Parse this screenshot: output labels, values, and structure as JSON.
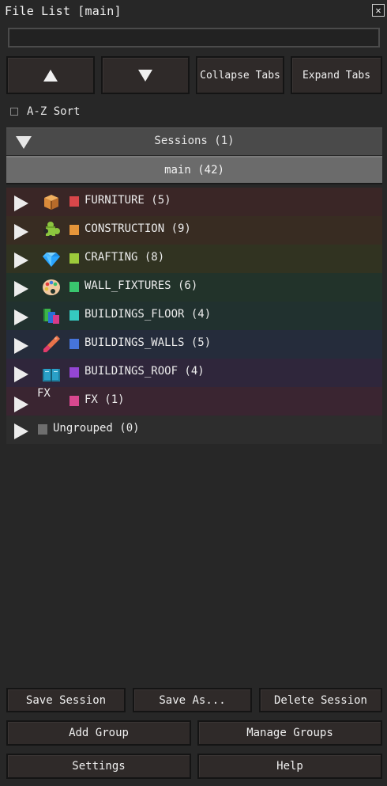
{
  "window": {
    "title": "File List [main]",
    "close_glyph": "✕"
  },
  "search": {
    "value": "",
    "placeholder": ""
  },
  "nav_buttons": {
    "up_icon": "arrow-up-icon",
    "down_icon": "arrow-down-icon",
    "collapse": "Collapse Tabs",
    "expand": "Expand Tabs"
  },
  "sort": {
    "label": "A-Z Sort",
    "checked": false
  },
  "sessions": {
    "label": "Sessions (1)",
    "active": "main (42)"
  },
  "groups": [
    {
      "label": "FURNITURE (5)",
      "color": "#d8474a",
      "icon": "box-icon",
      "bg": "#3a2626"
    },
    {
      "label": "CONSTRUCTION (9)",
      "color": "#e5953a",
      "icon": "puzzle-icon",
      "bg": "#382c22"
    },
    {
      "label": "CRAFTING (8)",
      "color": "#9cca3b",
      "icon": "gem-icon",
      "bg": "#313321"
    },
    {
      "label": "WALL_FIXTURES (6)",
      "color": "#39c66e",
      "icon": "palette-icon",
      "bg": "#22332a"
    },
    {
      "label": "BUILDINGS_FLOOR (4)",
      "color": "#35c9c0",
      "icon": "books-icon",
      "bg": "#21312f"
    },
    {
      "label": "BUILDINGS_WALLS (5)",
      "color": "#4674d9",
      "icon": "brush-icon",
      "bg": "#252c3b"
    },
    {
      "label": "BUILDINGS_ROOF (4)",
      "color": "#9446d4",
      "icon": "book-icon",
      "bg": "#2f263b"
    },
    {
      "label": "FX (1)",
      "color": "#d8488f",
      "icon": "fx-icon",
      "icon_text": "FX",
      "bg": "#3a2531"
    },
    {
      "label": "Ungrouped (0)",
      "color": "#6e6e6e",
      "icon": "",
      "bg": "#2d2d2d"
    }
  ],
  "bottom": {
    "save_session": "Save Session",
    "save_as": "Save As...",
    "delete_session": "Delete Session",
    "add_group": "Add Group",
    "manage_groups": "Manage Groups",
    "settings": "Settings",
    "help": "Help"
  }
}
